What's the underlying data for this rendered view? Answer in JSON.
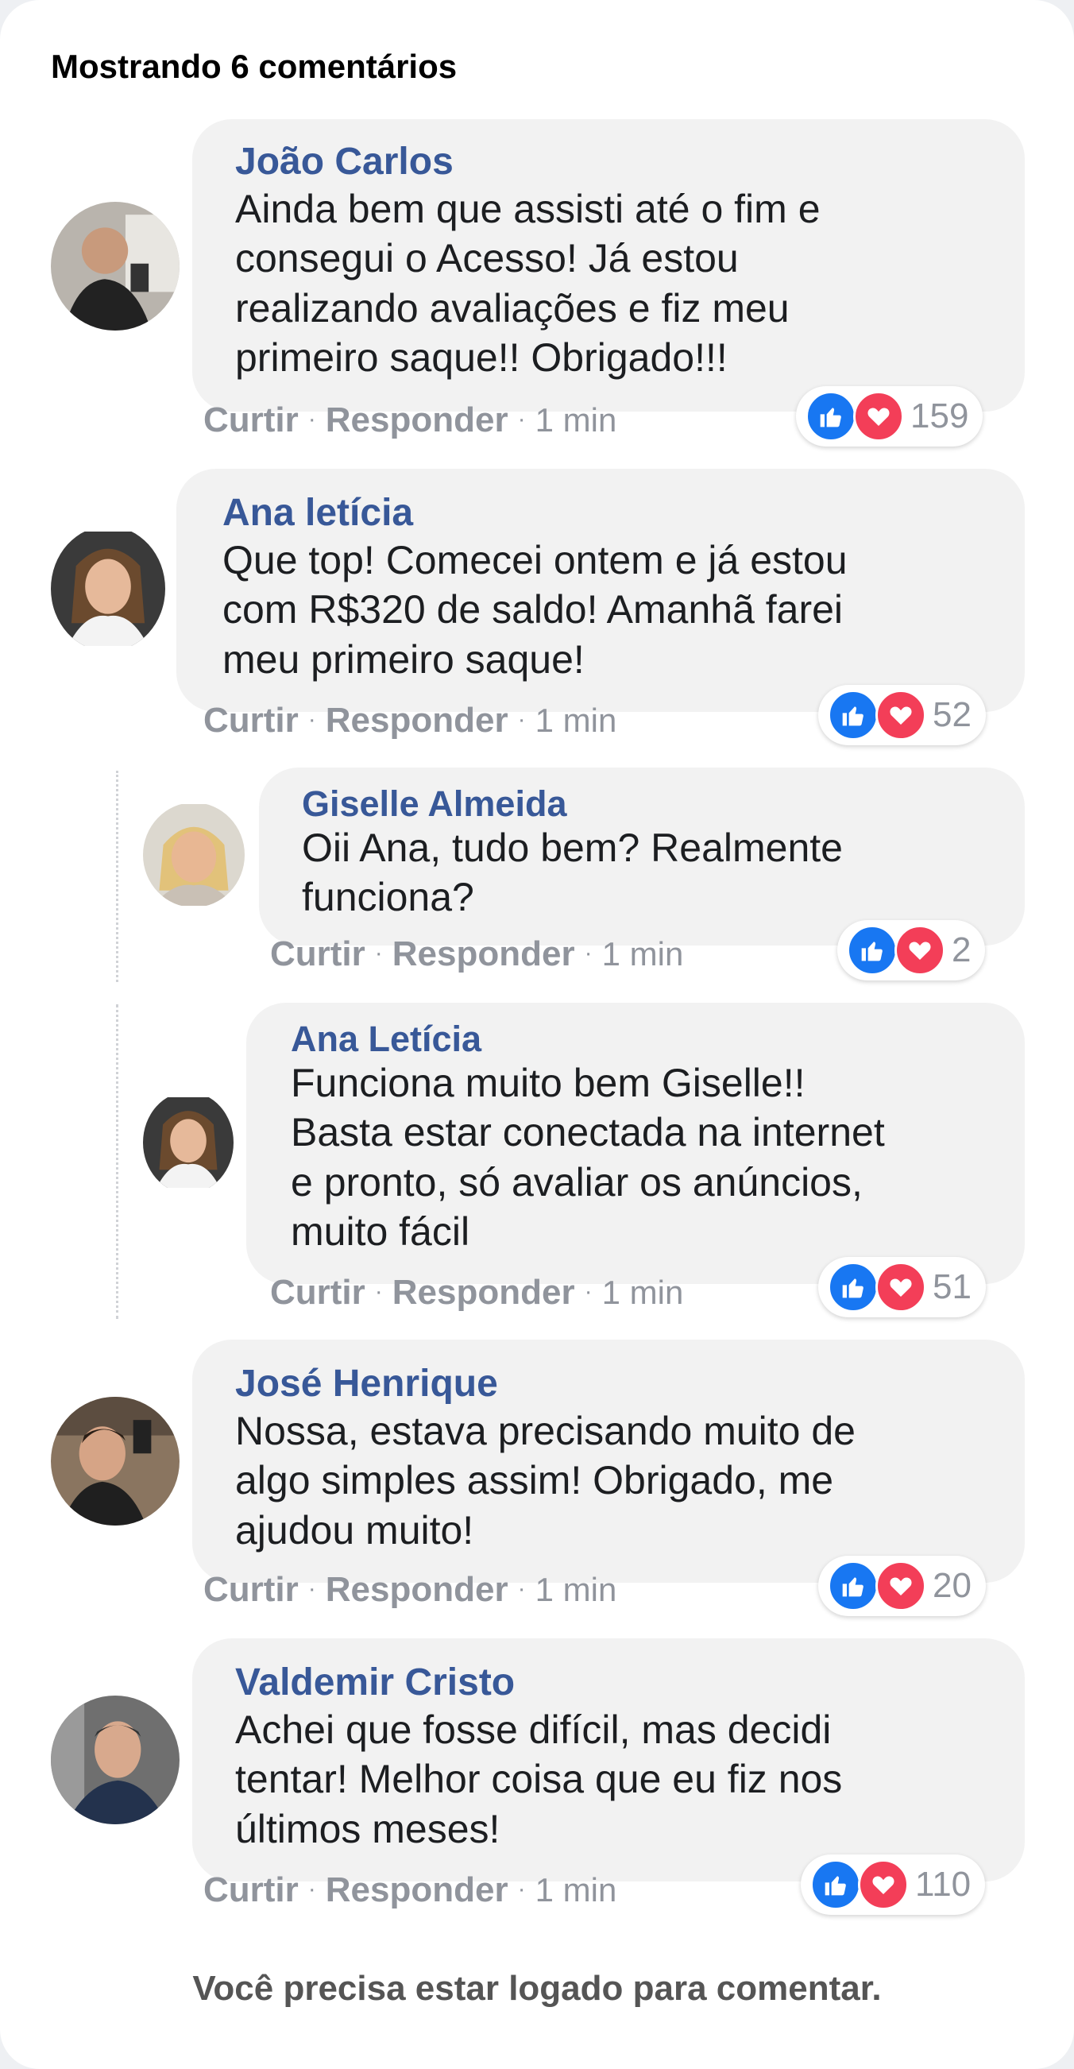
{
  "heading": "Mostrando 6 comentários",
  "actions": {
    "like": "Curtir",
    "reply": "Responder",
    "separator": "·"
  },
  "comments": [
    {
      "author": "João Carlos",
      "lines": [
        "Ainda bem que assisti até o fim e",
        "consegui o Acesso! Já estou",
        "realizando avaliações e fiz meu",
        "primeiro saque!! Obrigado!!!"
      ],
      "time": "1 min",
      "reactions": 159
    },
    {
      "author": "Ana letícia",
      "lines": [
        "Que top! Comecei ontem e já estou",
        "com R$320 de saldo! Amanhã farei",
        "meu primeiro saque!"
      ],
      "time": "1 min",
      "reactions": 52
    },
    {
      "author": "Giselle Almeida",
      "lines": [
        "Oii Ana, tudo bem? Realmente",
        "funciona?"
      ],
      "time": "1 min",
      "reactions": 2
    },
    {
      "author": "Ana Letícia",
      "lines": [
        "Funciona muito bem Giselle!!",
        "Basta estar conectada na internet",
        "e pronto, só avaliar os anúncios,",
        "muito fácil"
      ],
      "time": "1 min",
      "reactions": 51
    },
    {
      "author": "José Henrique",
      "lines": [
        "Nossa, estava precisando muito de",
        "algo simples assim! Obrigado, me",
        "ajudou muito!"
      ],
      "time": "1 min",
      "reactions": 20
    },
    {
      "author": "Valdemir Cristo",
      "lines": [
        "Achei que fosse difícil, mas decidi",
        "tentar! Melhor coisa que eu fiz nos",
        "últimos meses!"
      ],
      "time": "1 min",
      "reactions": 110
    }
  ],
  "footer": "Você precisa estar logado para comentar.",
  "colors": {
    "author": "#385898",
    "like": "#1877f2",
    "love": "#f33e58",
    "muted": "#90949c"
  },
  "icons": {
    "like": "thumbs-up-icon",
    "love": "heart-icon"
  }
}
